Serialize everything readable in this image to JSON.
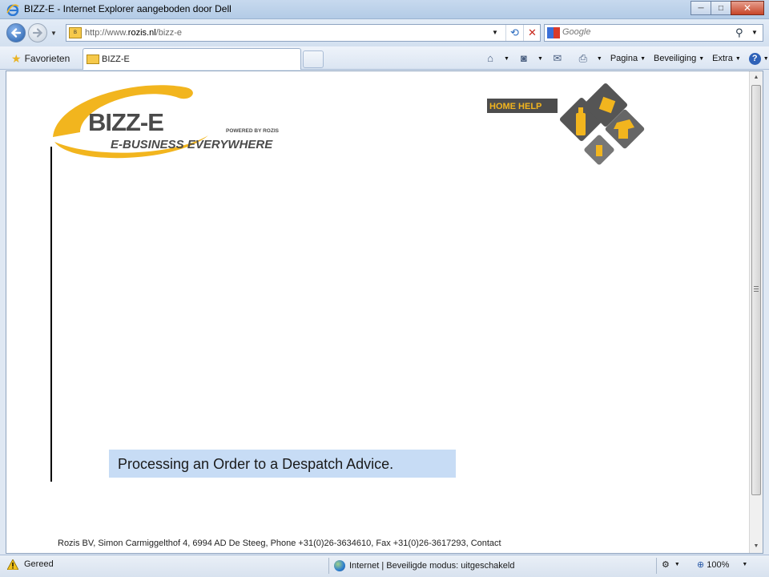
{
  "window": {
    "title": "BIZZ-E - Internet Explorer aangeboden door Dell",
    "controls": {
      "minimize": "─",
      "maximize": "□",
      "close": "✕"
    }
  },
  "address_bar": {
    "url_prefix": "http://www.",
    "url_domain": "rozis.nl",
    "url_path": "/bizz-e",
    "search_placeholder": "Google"
  },
  "command_bar": {
    "favorites_label": "Favorieten",
    "tab_label": "BIZZ-E",
    "commands": [
      {
        "label": "Pagina",
        "icon": "page-icon"
      },
      {
        "label": "Beveiliging",
        "icon": "safety-icon"
      },
      {
        "label": "Extra",
        "icon": "tools-icon"
      }
    ]
  },
  "page": {
    "logo": {
      "brand": "BIZZ-E",
      "powered_by": "POWERED BY ROZIS",
      "tagline": "E-BUSINESS EVERYWHERE"
    },
    "nav_label": "HOME HELP",
    "caption": "Processing an Order to a Despatch Advice.",
    "footer": "Rozis BV, Simon Carmiggelthof 4, 6994 AD De Steeg, Phone +31(0)26-3634610, Fax +31(0)26-3617293, Contact"
  },
  "status_bar": {
    "status": "Gereed",
    "zone": "Internet | Beveiligde modus: uitgeschakeld",
    "zoom": "100%"
  },
  "colors": {
    "brand_yellow": "#f2b51e",
    "brand_grey": "#4a4a4a",
    "caption_bg": "#c7dcf5"
  }
}
